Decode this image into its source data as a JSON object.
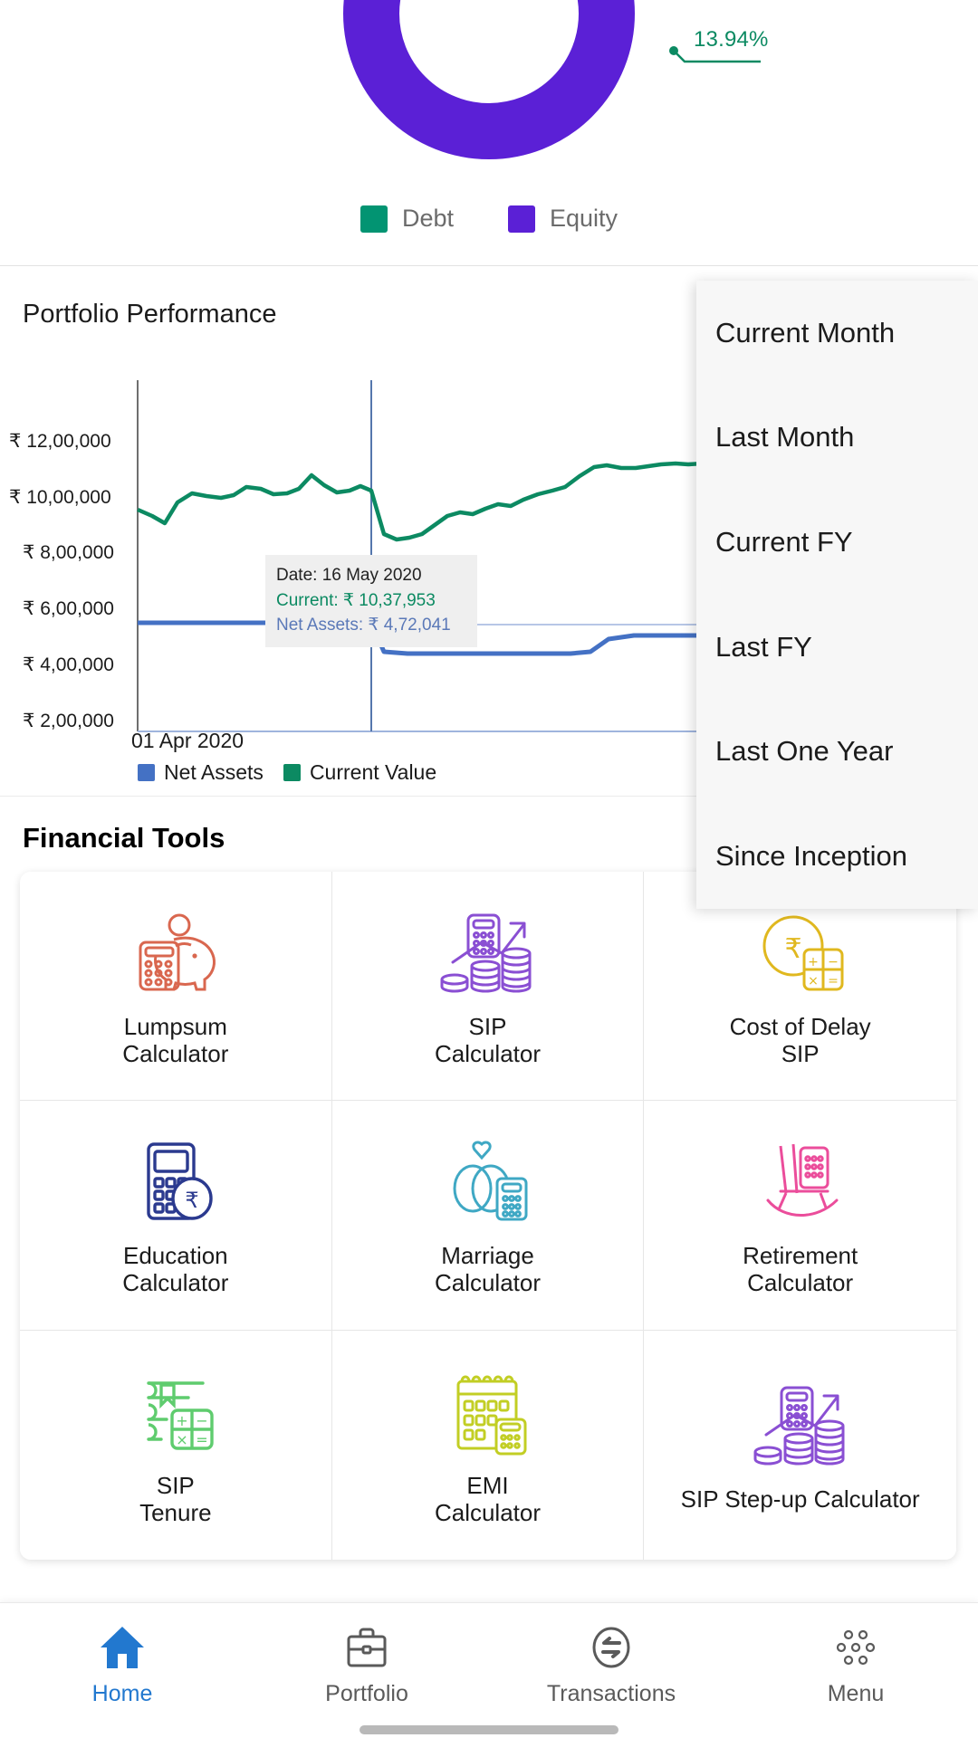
{
  "allocation": {
    "callout_pct": "13.94%",
    "legend": [
      {
        "label": "Debt",
        "color": "#029472"
      },
      {
        "label": "Equity",
        "color": "#5b20d6"
      }
    ]
  },
  "performance": {
    "title": "Portfolio Performance",
    "x_axis_start": "01 Apr 2020",
    "y_ticks": [
      "₹ 12,00,000",
      "₹ 10,00,000",
      "₹ 8,00,000",
      "₹ 6,00,000",
      "₹ 4,00,000",
      "₹ 2,00,000"
    ],
    "legend": [
      {
        "label": "Net Assets",
        "color": "#4471c4"
      },
      {
        "label": "Current Value",
        "color": "#0c8a62"
      }
    ],
    "tooltip": {
      "date": "Date: 16 May 2020",
      "current": "Current: ₹ 10,37,953",
      "net_assets": "Net Assets: ₹ 4,72,041"
    }
  },
  "period_dropdown": {
    "items": [
      {
        "label": "Current Month"
      },
      {
        "label": "Last Month"
      },
      {
        "label": "Current FY"
      },
      {
        "label": "Last FY"
      },
      {
        "label": "Last One Year"
      },
      {
        "label": "Since Inception"
      }
    ]
  },
  "financial_tools": {
    "title": "Financial Tools",
    "items": [
      {
        "label": "Lumpsum\nCalculator",
        "icon": "piggy-bank-calculator-icon",
        "color": "#d9674f"
      },
      {
        "label": "SIP\nCalculator",
        "icon": "coins-growth-calculator-icon",
        "color": "#8a4fd3"
      },
      {
        "label": "Cost of Delay\nSIP",
        "icon": "rupee-coin-calculator-icon",
        "color": "#e0b81f"
      },
      {
        "label": "Education\nCalculator",
        "icon": "calculator-rupee-icon",
        "color": "#2b3a8f"
      },
      {
        "label": "Marriage\nCalculator",
        "icon": "wedding-rings-calculator-icon",
        "color": "#3fa8c4"
      },
      {
        "label": "Retirement\nCalculator",
        "icon": "rocking-chair-icon",
        "color": "#eb4d9b"
      },
      {
        "label": "SIP\nTenure",
        "icon": "notebook-math-icon",
        "color": "#5fcc6e"
      },
      {
        "label": "EMI\nCalculator",
        "icon": "calendar-calculator-icon",
        "color": "#c2ce24"
      },
      {
        "label": "SIP Step-up Calculator",
        "icon": "coins-growth-calculator-icon",
        "color": "#8a4fd3"
      }
    ]
  },
  "bottom_nav": {
    "active_color": "#2278cf",
    "items": [
      {
        "label": "Home",
        "icon": "home-icon",
        "active": true
      },
      {
        "label": "Portfolio",
        "icon": "briefcase-icon",
        "active": false
      },
      {
        "label": "Transactions",
        "icon": "exchange-icon",
        "active": false
      },
      {
        "label": "Menu",
        "icon": "dots-cluster-icon",
        "active": false
      }
    ]
  }
}
